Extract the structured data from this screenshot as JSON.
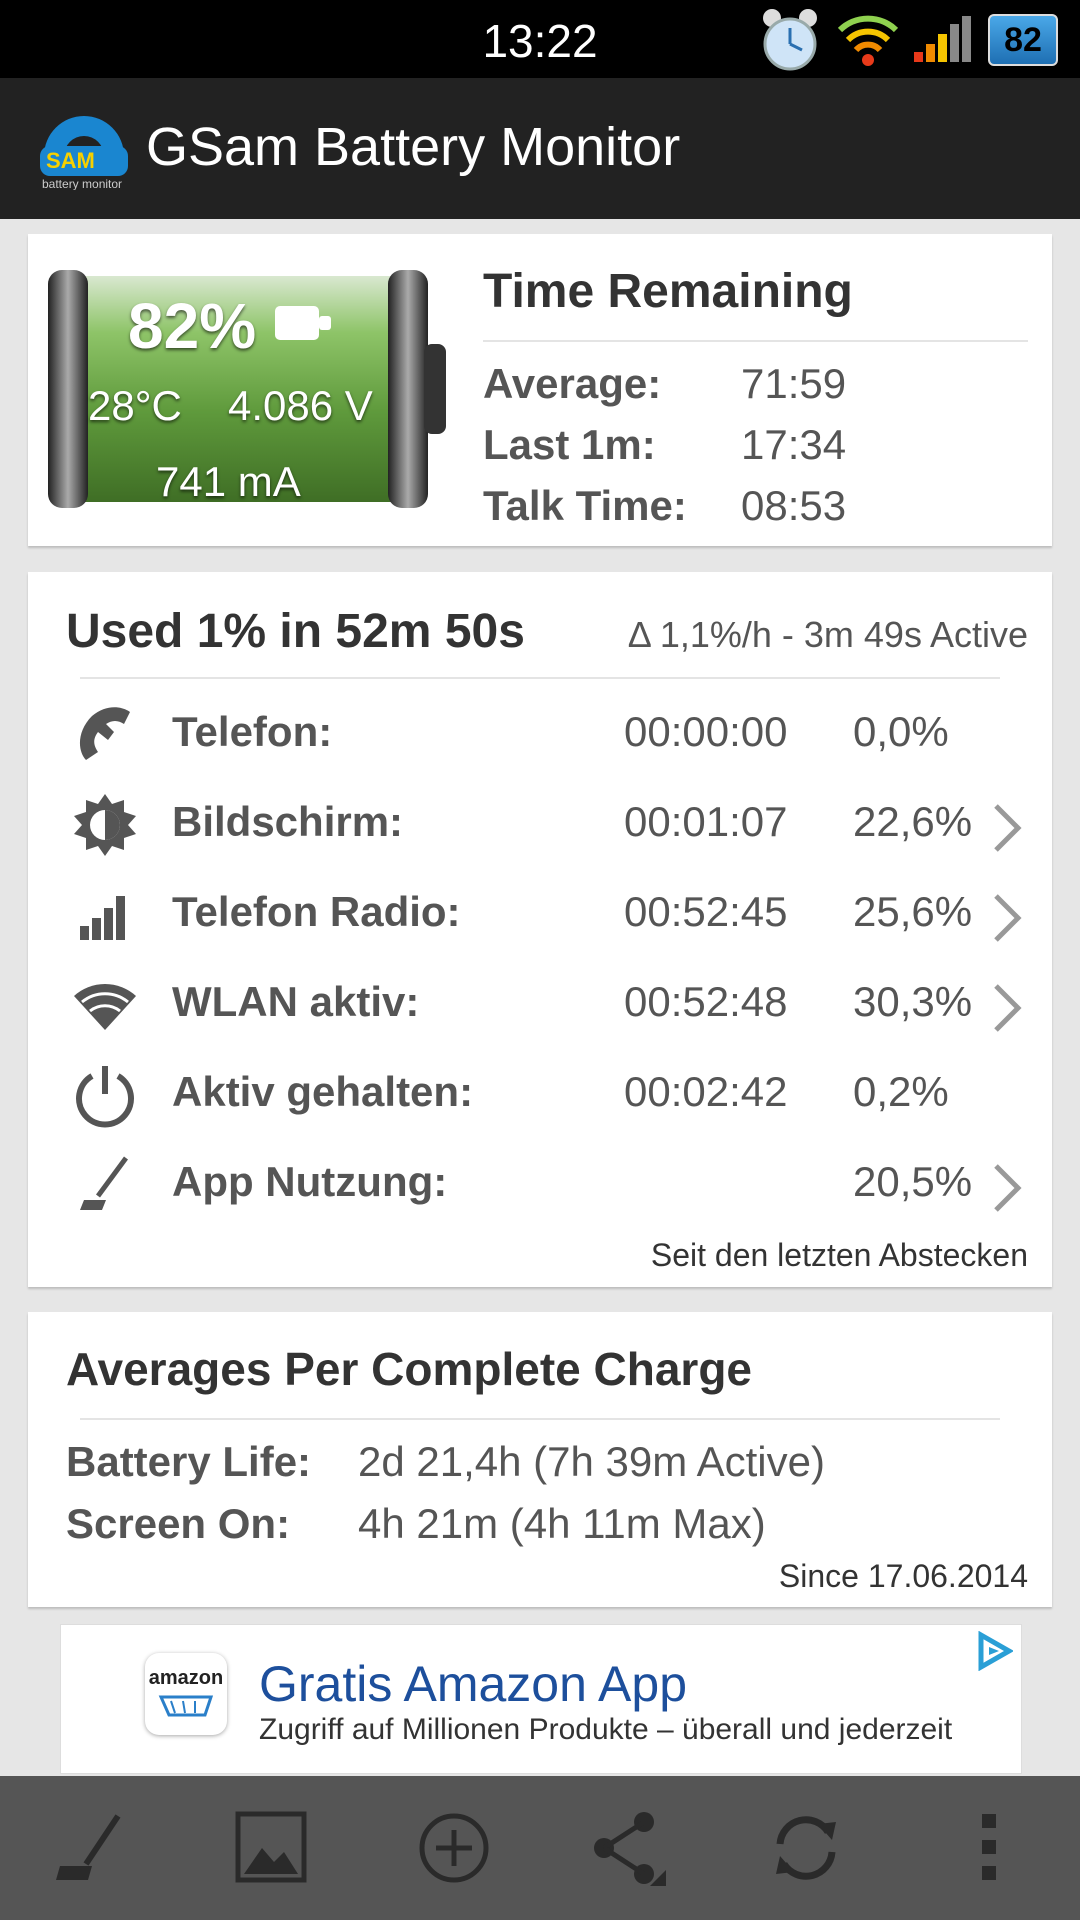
{
  "status_bar": {
    "time": "13:22",
    "battery_level": "82",
    "icons": [
      "alarm-clock-icon",
      "wifi-icon",
      "signal-icon",
      "battery-icon"
    ]
  },
  "action_bar": {
    "logo_text": "SAM",
    "logo_subtext": "battery monitor",
    "title": "GSam Battery Monitor"
  },
  "battery_card": {
    "percent": "82%",
    "temperature": "28°C",
    "voltage": "4.086 V",
    "current": "741 mA",
    "level_fraction": 0.82,
    "time_remaining": {
      "title": "Time Remaining",
      "rows": [
        {
          "label": "Average:",
          "value": "71:59"
        },
        {
          "label": "Last 1m:",
          "value": "17:34"
        },
        {
          "label": "Talk Time:",
          "value": "08:53"
        }
      ]
    }
  },
  "usage_card": {
    "title": "Used 1% in 52m 50s",
    "delta": "Δ 1,1%/h - 3m 49s Active",
    "rows": [
      {
        "icon": "phone-icon",
        "label": "Telefon:",
        "duration": "00:00:00",
        "percent": "0,0%",
        "has_chevron": false
      },
      {
        "icon": "screen-brightness-icon",
        "label": "Bildschirm:",
        "duration": "00:01:07",
        "percent": "22,6%",
        "has_chevron": true
      },
      {
        "icon": "signal-bars-icon",
        "label": "Telefon Radio:",
        "duration": "00:52:45",
        "percent": "25,6%",
        "has_chevron": true
      },
      {
        "icon": "wifi-icon",
        "label": "WLAN aktiv:",
        "duration": "00:52:48",
        "percent": "30,3%",
        "has_chevron": true
      },
      {
        "icon": "power-icon",
        "label": "Aktiv gehalten:",
        "duration": "00:02:42",
        "percent": "0,2%",
        "has_chevron": false
      },
      {
        "icon": "app-usage-icon",
        "label": "App Nutzung:",
        "duration": "",
        "percent": "20,5%",
        "has_chevron": true
      }
    ],
    "since": "Seit den letzten Abstecken"
  },
  "averages_card": {
    "title": "Averages Per Complete Charge",
    "rows": [
      {
        "label": "Battery Life:",
        "value": "2d 21,4h (7h 39m Active)"
      },
      {
        "label": "Screen On:",
        "value": "4h 21m (4h 11m Max)"
      }
    ],
    "since": "Since 17.06.2014"
  },
  "ad": {
    "logo_text": "amazon",
    "title": "Gratis Amazon App",
    "subtitle": "Zugriff auf Millionen Produkte – überall und jederzeit"
  },
  "bottom_bar": {
    "items": [
      "app-usage-icon",
      "image-icon",
      "add-circle-icon",
      "share-icon",
      "refresh-icon",
      "overflow-menu-icon"
    ]
  },
  "colors": {
    "statusbar": "#000000",
    "actionbar": "#222222",
    "background": "#e6e6e6",
    "battery_green": "#5f9a3c",
    "ad_blue": "#1d4f9c",
    "bottombar": "#555555"
  }
}
